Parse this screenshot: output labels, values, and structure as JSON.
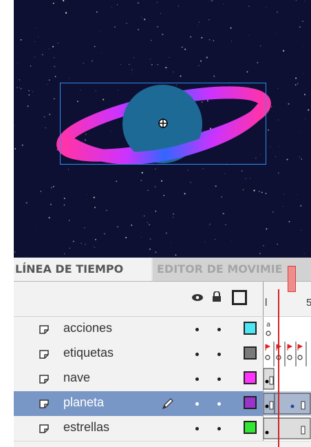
{
  "tabs": {
    "timeline": "LÍNEA DE TIEMPO",
    "motion_editor": "EDITOR DE MOVIMIE"
  },
  "header": {
    "eye_icon": "eye-icon",
    "lock_icon": "lock-icon",
    "outline_icon": "outline-square-icon",
    "ruler_ticks": [
      "l",
      "5"
    ]
  },
  "layers": [
    {
      "name": "acciones",
      "color": "#4de6f5",
      "selected": false
    },
    {
      "name": "etiquetas",
      "color": "#7a7a7a",
      "selected": false
    },
    {
      "name": "nave",
      "color": "#ff33ff",
      "selected": false
    },
    {
      "name": "planeta",
      "color": "#9933cc",
      "selected": true
    },
    {
      "name": "estrellas",
      "color": "#33e633",
      "selected": false
    }
  ],
  "colors": {
    "stage_background": "#0d1033",
    "planet": "#1e6a96",
    "selection": "#2f8ef0",
    "playhead": "#d02020"
  }
}
